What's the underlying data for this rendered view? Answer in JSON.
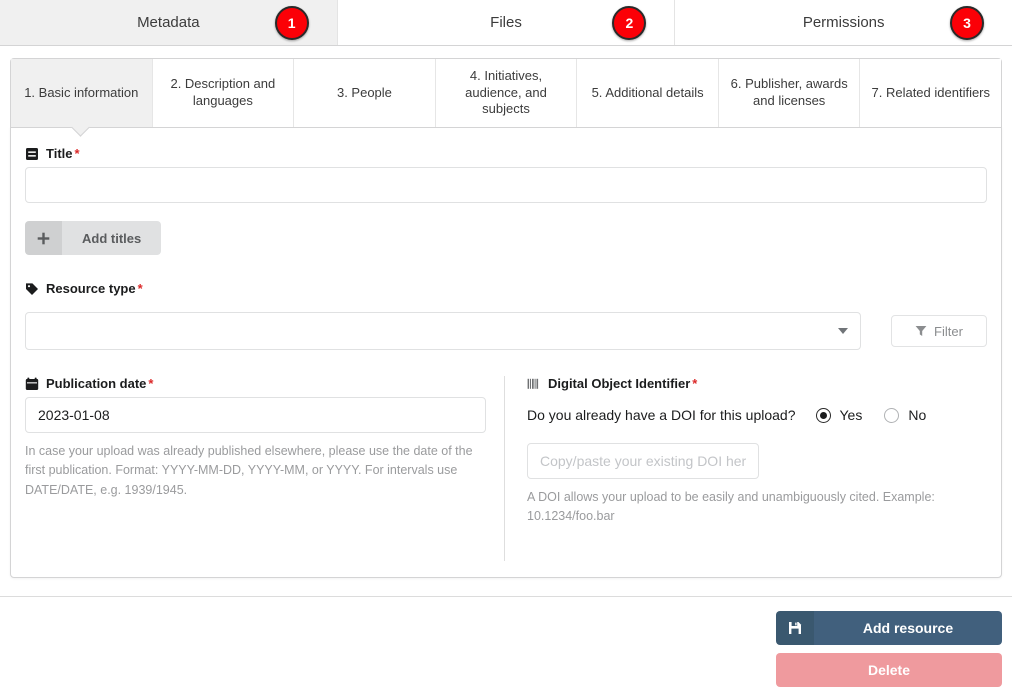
{
  "top_tabs": [
    {
      "label": "Metadata",
      "badge": "1",
      "active": true
    },
    {
      "label": "Files",
      "badge": "2",
      "active": false
    },
    {
      "label": "Permissions",
      "badge": "3",
      "active": false
    }
  ],
  "step_tabs": [
    {
      "label": "1. Basic information",
      "active": true
    },
    {
      "label": "2. Description and languages",
      "active": false
    },
    {
      "label": "3. People",
      "active": false
    },
    {
      "label": "4. Initiatives, audience, and subjects",
      "active": false
    },
    {
      "label": "5. Additional details",
      "active": false
    },
    {
      "label": "6. Publisher, awards and licenses",
      "active": false
    },
    {
      "label": "7. Related identifiers",
      "active": false
    }
  ],
  "form": {
    "title": {
      "label": "Title",
      "required_mark": "*",
      "value": "",
      "placeholder": "",
      "add_button_label": "Add titles"
    },
    "resource_type": {
      "label": "Resource type",
      "required_mark": "*",
      "selected_value": "",
      "filter_button_label": "Filter"
    },
    "publication_date": {
      "label": "Publication date",
      "required_mark": "*",
      "value": "2023-01-08",
      "hint": "In case your upload was already published elsewhere, please use the date of the first publication. Format: YYYY-MM-DD, YYYY-MM, or YYYY. For intervals use DATE/DATE, e.g. 1939/1945."
    },
    "doi": {
      "label": "Digital Object Identifier",
      "required_mark": "*",
      "question": "Do you already have a DOI for this upload?",
      "options": [
        {
          "label": "Yes",
          "selected": true
        },
        {
          "label": "No",
          "selected": false
        }
      ],
      "value": "",
      "placeholder": "Copy/paste your existing DOI here",
      "hint": "A DOI allows your upload to be easily and unambiguously cited. Example: 10.1234/foo.bar"
    }
  },
  "footer": {
    "add_resource_label": "Add resource",
    "delete_label": "Delete"
  },
  "colors": {
    "badge_red": "#fb0007",
    "required_red": "#db2828",
    "primary_button": "#41607d",
    "delete_button": "#ef9a9e",
    "active_tab_bg": "#f0f0f0"
  }
}
